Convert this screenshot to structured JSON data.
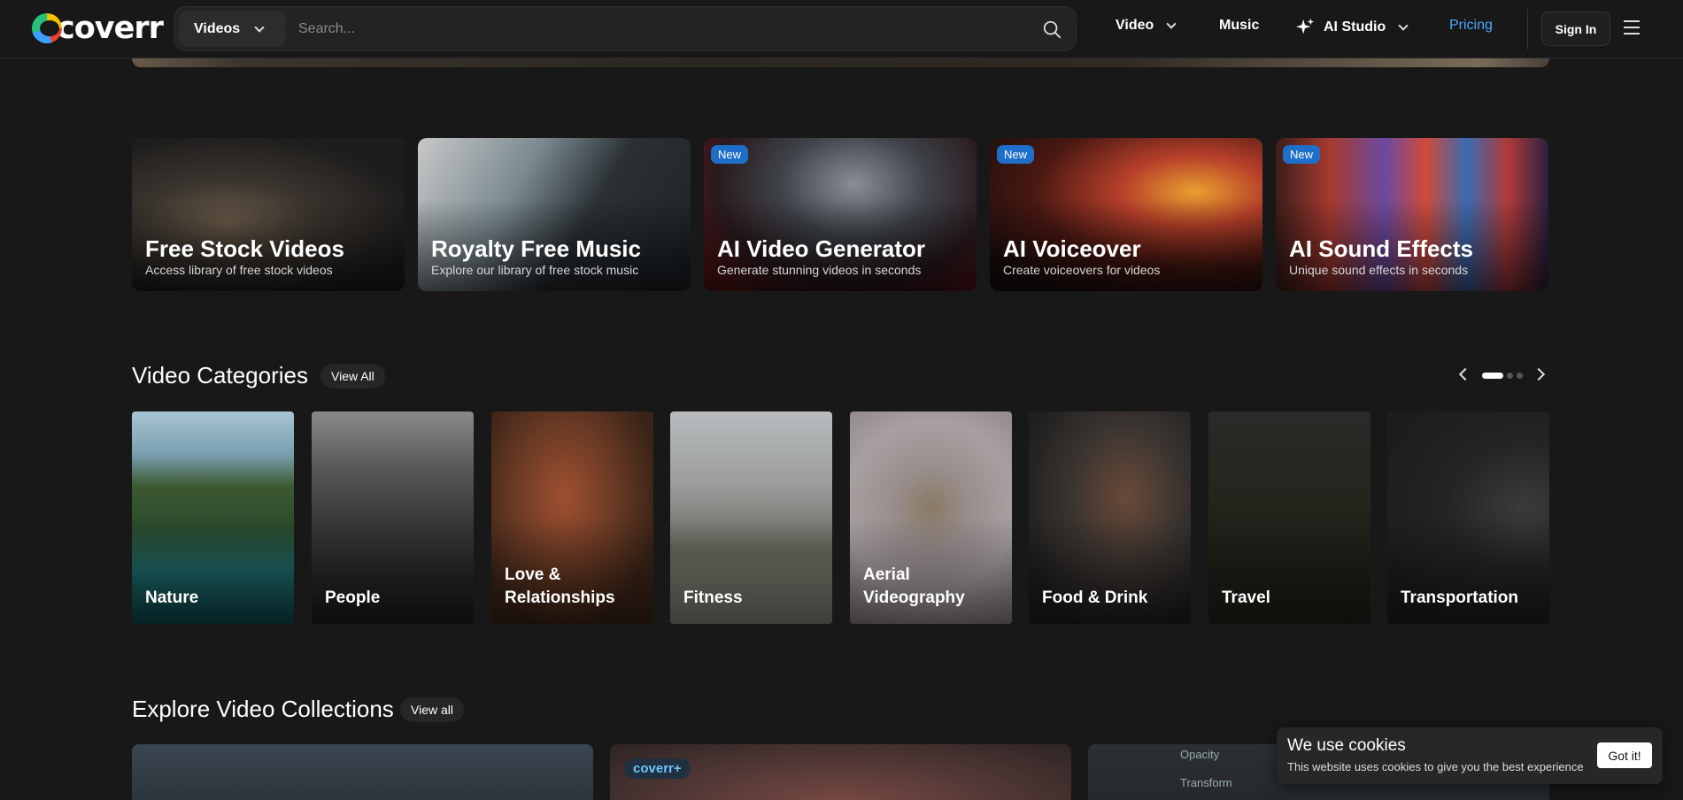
{
  "header": {
    "logo_text": "coverr",
    "search_type": "Videos",
    "search_placeholder": "Search...",
    "nav": {
      "video": "Video",
      "music": "Music",
      "ai_studio": "AI Studio",
      "pricing": "Pricing"
    },
    "sign_in": "Sign In"
  },
  "features": [
    {
      "title": "Free Stock Videos",
      "subtitle": "Access library of free stock videos",
      "badge": ""
    },
    {
      "title": "Royalty Free Music",
      "subtitle": "Explore our library of free stock music",
      "badge": ""
    },
    {
      "title": "AI Video Generator",
      "subtitle": "Generate stunning videos in seconds",
      "badge": "New"
    },
    {
      "title": "AI Voiceover",
      "subtitle": "Create voiceovers for videos",
      "badge": "New"
    },
    {
      "title": "AI Sound Effects",
      "subtitle": "Unique sound effects in seconds",
      "badge": "New"
    }
  ],
  "categories_section": {
    "title": "Video Categories",
    "view_all": "View All",
    "items": [
      {
        "label": "Nature"
      },
      {
        "label": "People"
      },
      {
        "label": "Love & Relationships"
      },
      {
        "label": "Fitness"
      },
      {
        "label": "Aerial Videography"
      },
      {
        "label": "Food & Drink"
      },
      {
        "label": "Travel"
      },
      {
        "label": "Transportation"
      }
    ]
  },
  "collections_section": {
    "title": "Explore Video Collections",
    "view_all": "View all",
    "badge": "coverr+",
    "panel_labels": [
      "Opacity",
      "Transform"
    ]
  },
  "cookie": {
    "title": "We use cookies",
    "text": "This website uses cookies to give you the best experience",
    "button": "Got it!"
  },
  "colors": {
    "background": "#181818",
    "accent": "#4fa7ff",
    "badge": "#1e6fc9"
  }
}
